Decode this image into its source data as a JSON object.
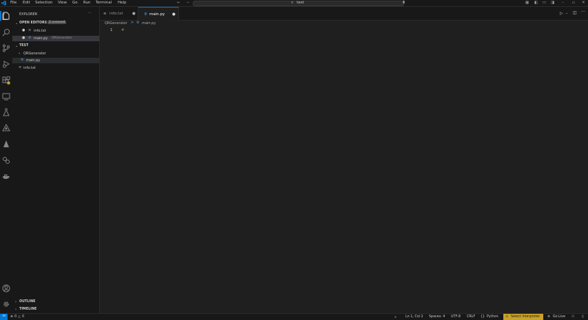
{
  "menu": [
    "File",
    "Edit",
    "Selection",
    "View",
    "Go",
    "Run",
    "Terminal",
    "Help"
  ],
  "search_text": "test",
  "explorer": {
    "title": "EXPLORER",
    "open_editors_label": "OPEN EDITORS",
    "unsaved_badge": "2 unsaved",
    "open_files": [
      {
        "name": "info.txt",
        "path": ""
      },
      {
        "name": "main.py",
        "path": "QRGenerator"
      }
    ],
    "workspace_label": "TEST",
    "folder": "QRGenerator",
    "tree_files": [
      "main.py",
      "info.txt"
    ],
    "outline_label": "OUTLINE",
    "timeline_label": "TIMELINE"
  },
  "tabs": [
    {
      "label": "info.txt",
      "active": false,
      "modified": true
    },
    {
      "label": "main.py",
      "active": true,
      "modified": true
    }
  ],
  "breadcrumb": {
    "folder": "QRGenerator",
    "sep": ">",
    "file": "main.py"
  },
  "editor": {
    "line_number": "1",
    "code": "#"
  },
  "status": {
    "errors": "0",
    "warnings": "0",
    "cursor": "Ln 1, Col 2",
    "spaces": "Spaces: 4",
    "encoding": "UTF-8",
    "eol": "CRLF",
    "braces": "{}",
    "language": "Python",
    "interpreter": "Select Interpreter",
    "golive": "Go Live"
  },
  "colors": {
    "accent": "#0078d4",
    "warning_bg": "#c8a22a",
    "python_icon": "#5a9bd6"
  }
}
